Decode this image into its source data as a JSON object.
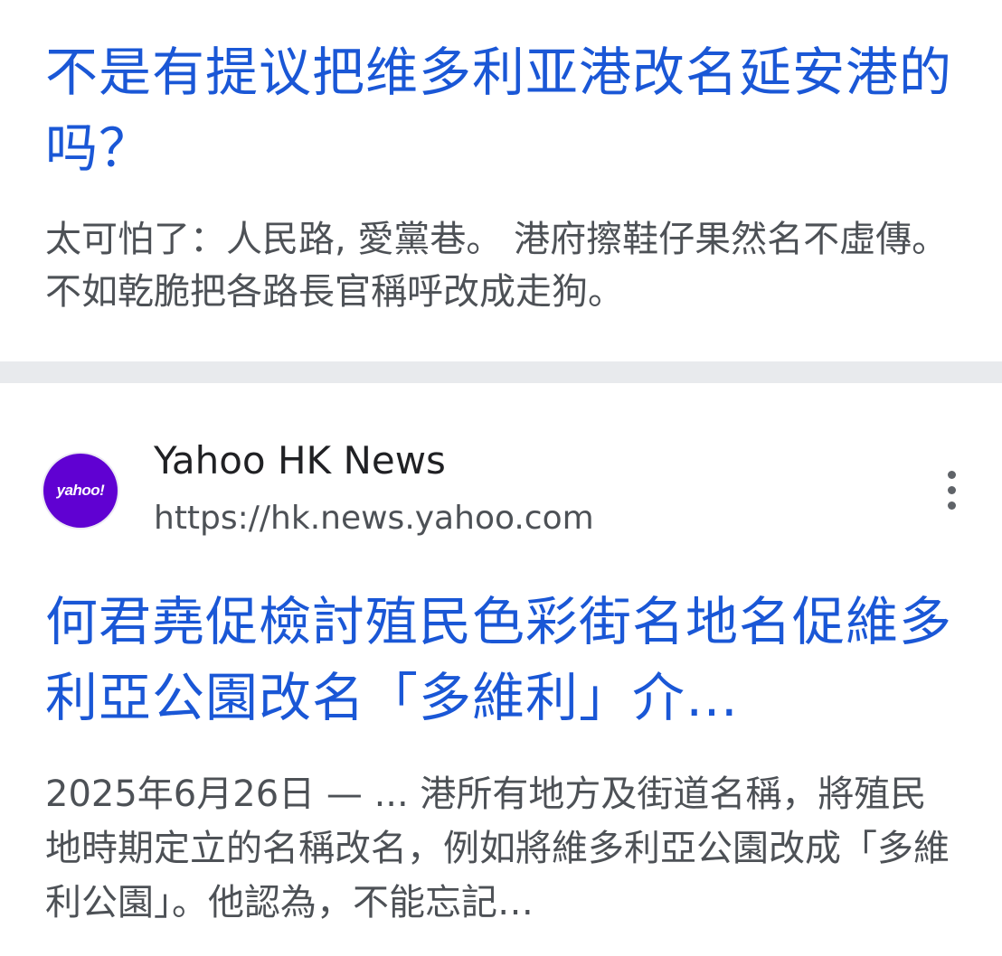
{
  "results": [
    {
      "title": "不是有提议把维多利亚港改名延安港的吗？",
      "snippet": "太可怕了：人民路, 愛黨巷。 港府擦鞋仔果然名不虛傳。 不如乾脆把各路長官稱呼改成走狗。"
    },
    {
      "source": {
        "name": "Yahoo HK News",
        "url": "https://hk.news.yahoo.com",
        "logo_text": "yahoo!",
        "logo_color": "#6001d2"
      },
      "title": "何君堯促檢討殖民色彩街名地名促維多利亞公園改名「多維利」介…",
      "snippet": "2025年6月26日 — ... 港所有地方及街道名稱，將殖民地時期定立的名稱改名，例如將維多利亞公園改成「多維利公園」。他認為，不能忘記…"
    }
  ],
  "icons": {
    "more": "more-vert-icon"
  },
  "colors": {
    "link": "#1a57d6",
    "snippet": "#4d5156",
    "divider": "#e8eaed"
  }
}
